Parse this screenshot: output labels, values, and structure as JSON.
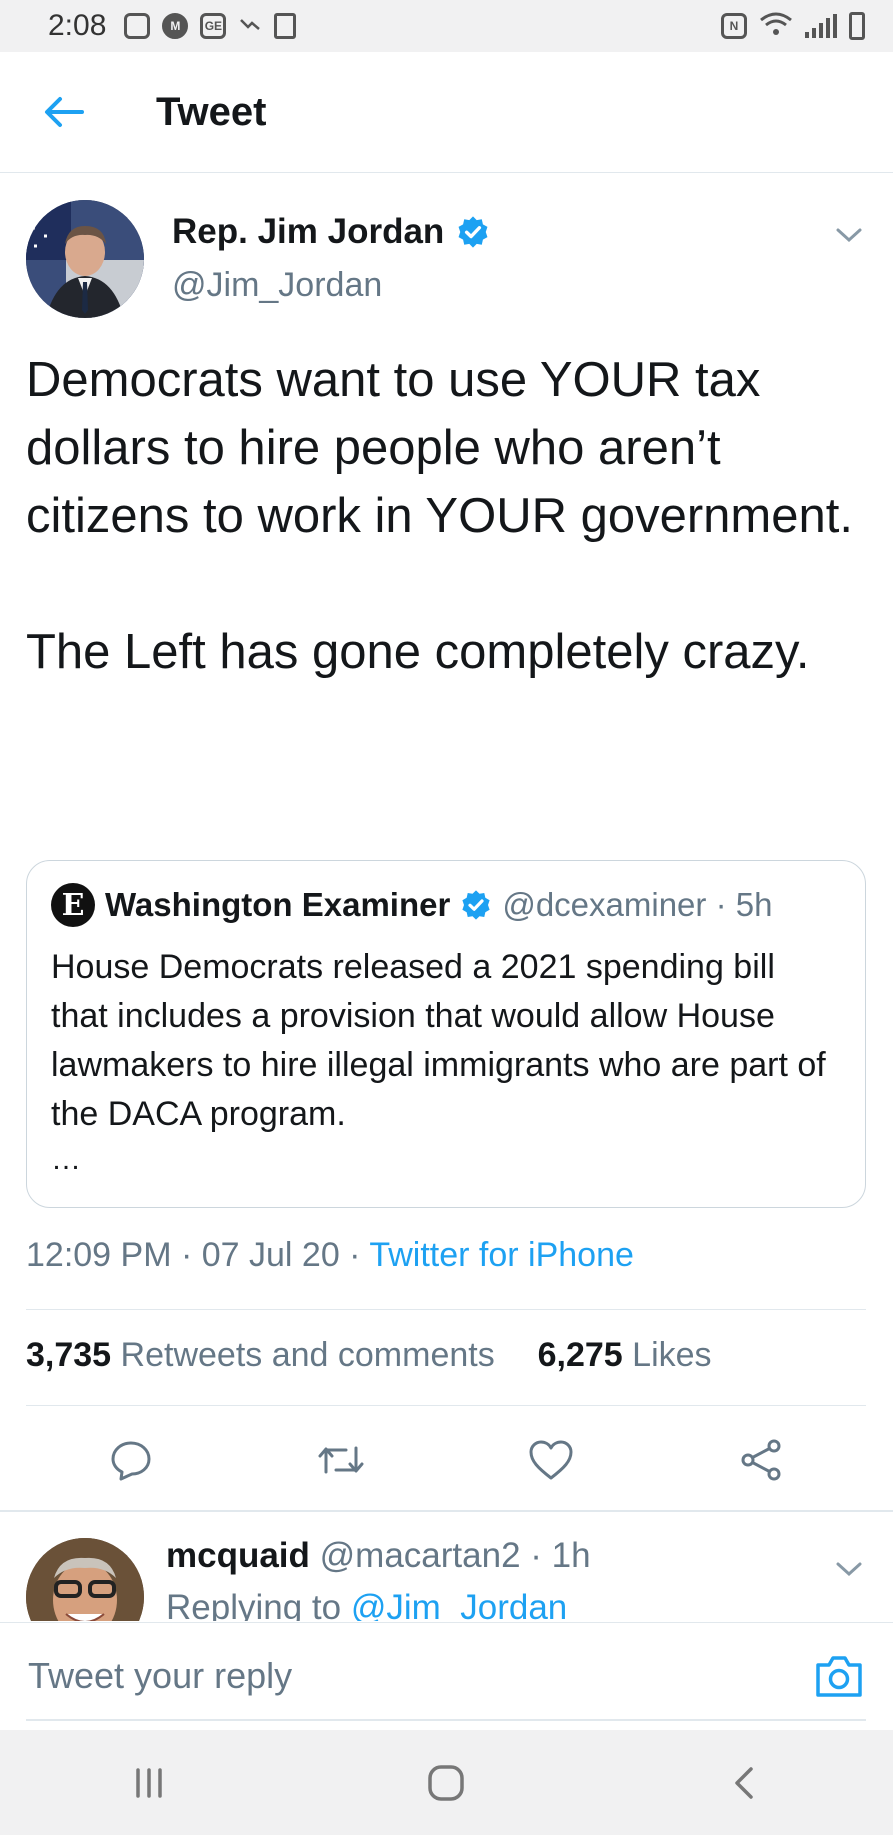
{
  "status_bar": {
    "time": "2:08"
  },
  "header": {
    "title": "Tweet"
  },
  "tweet": {
    "author_name": "Rep. Jim Jordan",
    "author_handle": "@Jim_Jordan",
    "paragraph1": "Democrats want to use YOUR tax dollars to hire people who aren’t citizens to work in YOUR government.",
    "paragraph2": "The Left has gone completely crazy.",
    "quote": {
      "name": "Washington Examiner",
      "handle": "@dcexaminer · 5h",
      "text": "House Democrats released a 2021 spending bill that includes a provision that would allow House lawmakers to hire illegal immigrants who are part of the DACA program.",
      "ellipsis": "…"
    },
    "timestamp": "12:09 PM · 07 Jul 20 · ",
    "source": "Twitter for iPhone",
    "retweets_count": "3,735",
    "retweets_label": " Retweets and comments",
    "likes_count": "6,275",
    "likes_label": " Likes"
  },
  "reply": {
    "name": "mcquaid",
    "handle": " @macartan2 · 1h",
    "replying_to_label": "Replying to ",
    "replying_to_handle": "@Jim_Jordan"
  },
  "compose": {
    "placeholder": "Tweet your reply"
  },
  "colors": {
    "accent": "#1da1f2",
    "text": "#14171a",
    "secondary": "#657786",
    "divider": "#e1e8ed"
  }
}
